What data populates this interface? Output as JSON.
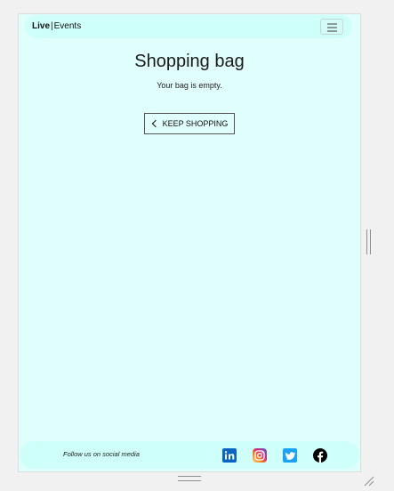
{
  "navbar": {
    "brand_bold": "Live",
    "brand_separator": "|",
    "brand_rest": "Events",
    "menu_icon": "hamburger-icon"
  },
  "main": {
    "title": "Shopping bag",
    "empty_message": "Your bag is empty.",
    "keep_shopping_label": "KEEP SHOPPING",
    "keep_shopping_icon": "chevron-left-icon"
  },
  "footer": {
    "follow_text": "Follow us on social media",
    "social": [
      {
        "icon": "linkedin-icon",
        "color": "#0a66c2"
      },
      {
        "icon": "instagram-icon",
        "color": "#d6249f"
      },
      {
        "icon": "twitter-icon",
        "color": "#1da1f2"
      },
      {
        "icon": "facebook-icon",
        "color": "#000000"
      }
    ]
  },
  "colors": {
    "page_background": "#e0fefb",
    "bar_background": "#cffff9"
  }
}
